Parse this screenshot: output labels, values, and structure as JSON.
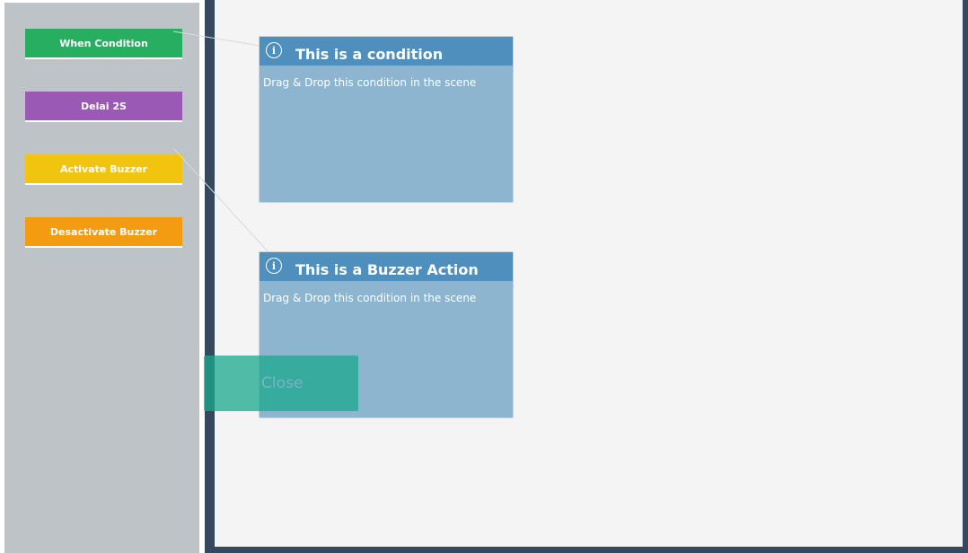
{
  "palette": {
    "blocks": [
      {
        "label": "When Condition",
        "color": "#27ae60"
      },
      {
        "label": "Delai 2S",
        "color": "#9b59b6"
      },
      {
        "label": "Activate Buzzer",
        "color": "#f1c40f"
      },
      {
        "label": "Desactivate Buzzer",
        "color": "#f39c12"
      }
    ]
  },
  "tooltips": [
    {
      "title": "This is a condition",
      "text": "Drag & Drop this condition in the scene",
      "icon": "info-icon"
    },
    {
      "title": "This is a Buzzer Action",
      "text": "Drag & Drop this condition in the scene",
      "icon": "info-icon"
    }
  ],
  "close_button": {
    "label": "Close"
  },
  "colors": {
    "palette_bg": "#bdc3c7",
    "scene_frame": "#34495e",
    "scene_bg": "#f4f4f4",
    "tooltip_header": "#4f8fbd",
    "tooltip_body": "#8eb5cf"
  }
}
